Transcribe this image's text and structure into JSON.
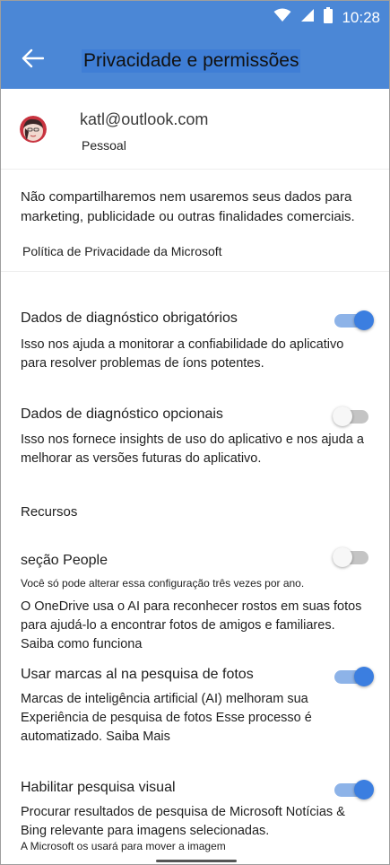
{
  "status_bar": {
    "time": "10:28"
  },
  "header": {
    "title": "Privacidade e permissões"
  },
  "account": {
    "email": "katl@outlook.com",
    "type": "Pessoal"
  },
  "notice": {
    "text": "Não compartilharemos nem usaremos seus dados para marketing, publicidade ou outras finalidades comerciais.",
    "link": "Política de Privacidade da Microsoft"
  },
  "settings": {
    "required": {
      "title": "Dados de diagnóstico obrigatórios",
      "desc": "Isso nos ajuda a monitorar a confiabilidade do aplicativo para resolver problemas de íons potentes.",
      "enabled": true
    },
    "optional": {
      "title": "Dados de diagnóstico opcionais",
      "desc": "Isso nos fornece insights de uso do aplicativo e nos ajuda a melhorar as versões futuras do aplicativo.",
      "enabled": false
    },
    "resources_label": "Recursos",
    "people": {
      "title": "seção People",
      "note": "Você só pode alterar essa configuração três vezes por ano.",
      "desc": "O OneDrive usa o AI para reconhecer rostos em suas fotos para ajudá-lo a encontrar fotos de amigos e familiares.",
      "link": "Saiba como funciona",
      "enabled": false
    },
    "ai_tags": {
      "title": "Usar marcas al na pesquisa de fotos",
      "desc": "Marcas de inteligência artificial (AI) melhoram sua Experiência de pesquisa de fotos Esse processo é automatizado.",
      "link": "Saiba Mais",
      "enabled": true
    },
    "visual_search": {
      "title": "Habilitar pesquisa visual",
      "desc": "Procurar resultados de pesquisa de Microsoft Notícias & Bing relevante para imagens selecionadas.",
      "note": "A Microsoft os usará para mover a imagem",
      "enabled": true
    }
  },
  "colors": {
    "brand": "#4b87d6",
    "toggle_on": "#3b7ee0"
  },
  "icons": {
    "back": "arrow-left-icon",
    "wifi": "wifi-icon",
    "signal": "signal-icon",
    "battery": "battery-icon"
  }
}
